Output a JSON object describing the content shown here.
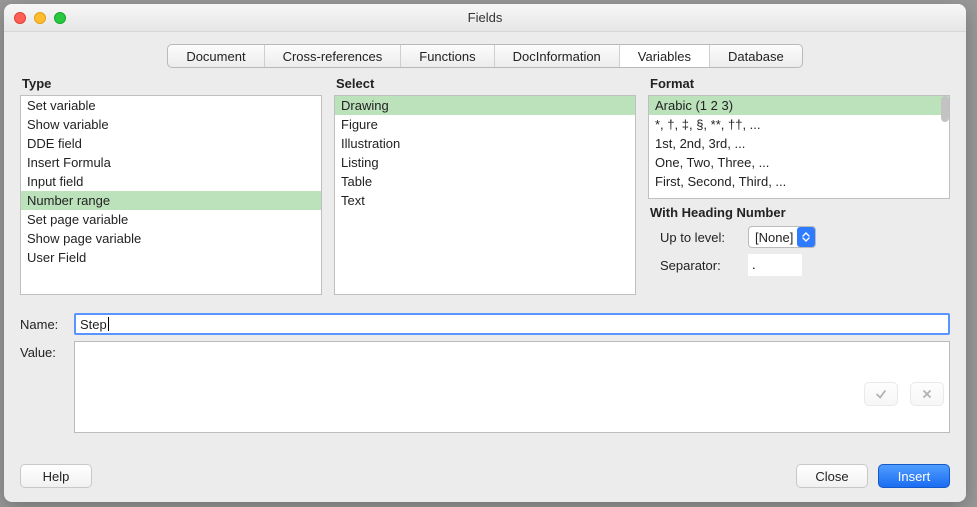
{
  "window": {
    "title": "Fields"
  },
  "tabs": [
    "Document",
    "Cross-references",
    "Functions",
    "DocInformation",
    "Variables",
    "Database"
  ],
  "active_tab_index": 4,
  "columns": {
    "type_label": "Type",
    "select_label": "Select",
    "format_label": "Format"
  },
  "type_items": [
    "Set variable",
    "Show variable",
    "DDE field",
    "Insert Formula",
    "Input field",
    "Number range",
    "Set page variable",
    "Show page variable",
    "User Field"
  ],
  "type_selected_index": 5,
  "select_items": [
    "Drawing",
    "Figure",
    "Illustration",
    "Listing",
    "Table",
    "Text"
  ],
  "select_selected_index": 0,
  "format_items": [
    "Arabic (1 2 3)",
    "*, †, ‡, §, **, ††, ...",
    "1st, 2nd, 3rd, ...",
    "One, Two, Three, ...",
    "First, Second, Third, ..."
  ],
  "format_selected_index": 0,
  "with_heading": {
    "title": "With Heading Number",
    "up_to_level_label": "Up to level:",
    "up_to_level_value": "[None]",
    "separator_label": "Separator:",
    "separator_value": "."
  },
  "name_label": "Name:",
  "name_value": "Step",
  "value_label": "Value:",
  "value_value": "",
  "buttons": {
    "help": "Help",
    "close": "Close",
    "insert": "Insert"
  }
}
